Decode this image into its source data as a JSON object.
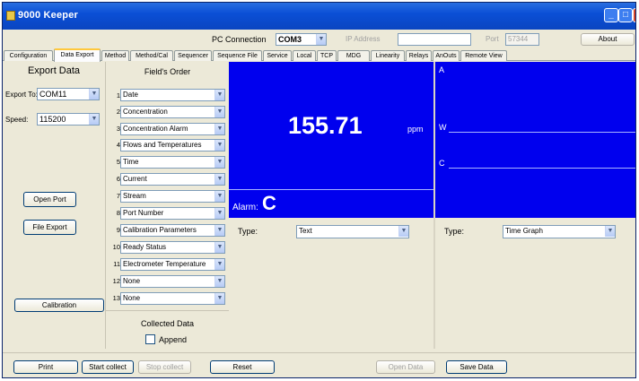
{
  "window": {
    "title": "9000 Keeper"
  },
  "connection": {
    "pc_label": "PC Connection",
    "pc_value": "COM3",
    "ip_label": "IP Address",
    "ip_value": "",
    "port_label": "Port",
    "port_value": "57344",
    "about_label": "About"
  },
  "tabs": [
    "Configuration",
    "Data Export",
    "Method",
    "Method/Cal",
    "Sequencer",
    "Sequence File",
    "Service",
    "Local",
    "TCP",
    "MDG",
    "Linearity",
    "Relays",
    "AnOuts",
    "Remote View"
  ],
  "active_tab": "Data Export",
  "export": {
    "heading": "Export Data",
    "export_to_label": "Export To:",
    "export_to_value": "COM11",
    "speed_label": "Speed:",
    "speed_value": "115200",
    "open_port_label": "Open Port",
    "file_export_label": "File Export",
    "calibration_label": "Calibration"
  },
  "fields_order": {
    "heading": "Field's Order",
    "rows": [
      {
        "num": "1",
        "value": "Date"
      },
      {
        "num": "2",
        "value": "Concentration"
      },
      {
        "num": "3",
        "value": "Concentration Alarm"
      },
      {
        "num": "4",
        "value": "Flows and Temperatures"
      },
      {
        "num": "5",
        "value": "Time"
      },
      {
        "num": "6",
        "value": "Current"
      },
      {
        "num": "7",
        "value": "Stream"
      },
      {
        "num": "8",
        "value": "Port Number"
      },
      {
        "num": "9",
        "value": "Calibration Parameters"
      },
      {
        "num": "10",
        "value": "Ready Status"
      },
      {
        "num": "11",
        "value": "Electrometer Temperature"
      },
      {
        "num": "12",
        "value": "None"
      },
      {
        "num": "13",
        "value": "None"
      }
    ]
  },
  "collected": {
    "heading": "Collected Data",
    "append_label": "Append"
  },
  "display": {
    "value": "155.71",
    "unit": "ppm",
    "alarm_label": "Alarm:",
    "alarm_value": "C",
    "type_label": "Type:",
    "type_value": "Text"
  },
  "graph": {
    "label_a": "A",
    "label_w": "W",
    "label_c": "C",
    "type_label": "Type:",
    "type_value": "Time Graph"
  },
  "bottom": {
    "print": "Print",
    "start_collect": "Start collect",
    "stop_collect": "Stop collect",
    "reset": "Reset",
    "open_data": "Open Data",
    "save_data": "Save Data"
  },
  "colors": {
    "display_bg": "#0000ee",
    "titlebar": "#0b4fd6"
  }
}
